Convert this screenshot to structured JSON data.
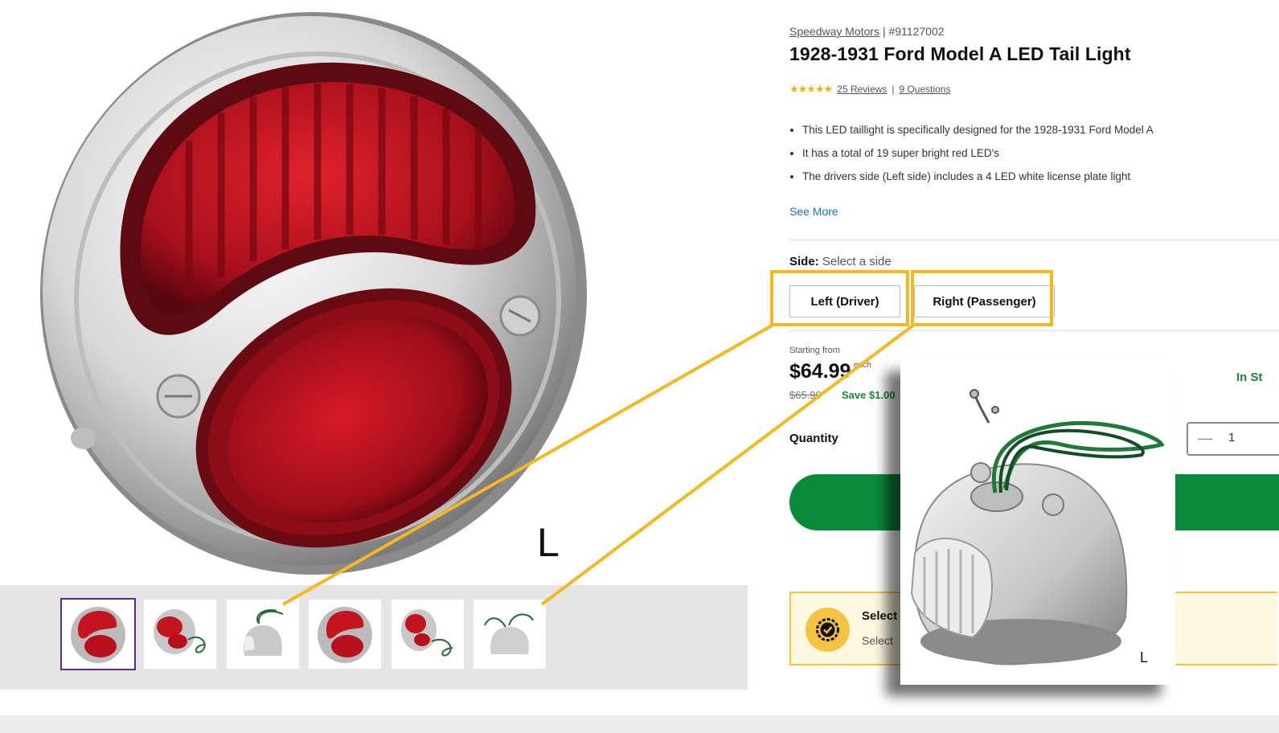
{
  "product": {
    "brand": "Speedway Motors",
    "separator": "|",
    "part_number": "#91127002",
    "title": "1928-1931 Ford Model A LED Tail Light",
    "rating": {
      "stars": "★★★★★",
      "value": 4.5,
      "reviews_link": "25 Reviews",
      "divider": "|",
      "questions_link": "9 Questions"
    },
    "bullets": [
      "This LED taillight is specifically designed for the 1928-1931 Ford Model A",
      "It has a total of 19 super bright red LED's",
      "The drivers side (Left side) includes a 4 LED white license plate light"
    ],
    "see_more": "See More"
  },
  "options": {
    "label": "Side:",
    "placeholder": "Select a side",
    "buttons": [
      "Left (Driver)",
      "Right (Passenger)"
    ]
  },
  "pricing": {
    "starting_label": "Starting from",
    "price": "$64.99",
    "unit": "each",
    "old_price": "$65.99",
    "save": "Save $1.00",
    "stock": "In St"
  },
  "quantity": {
    "label": "Quantity",
    "minus": "—",
    "value": "1"
  },
  "notice": {
    "title": "Select",
    "text": "Select"
  },
  "gallery": {
    "main_letter": "L",
    "popup_letter": "L",
    "thumbnail_count": 6,
    "selected_thumbnail": 1
  },
  "colors": {
    "accent_green": "#0b8a3c",
    "highlight_yellow": "#f5b820",
    "selected_border": "#5b2a86",
    "lens_red": "#b01020",
    "link_blue": "#1a6fc9"
  }
}
